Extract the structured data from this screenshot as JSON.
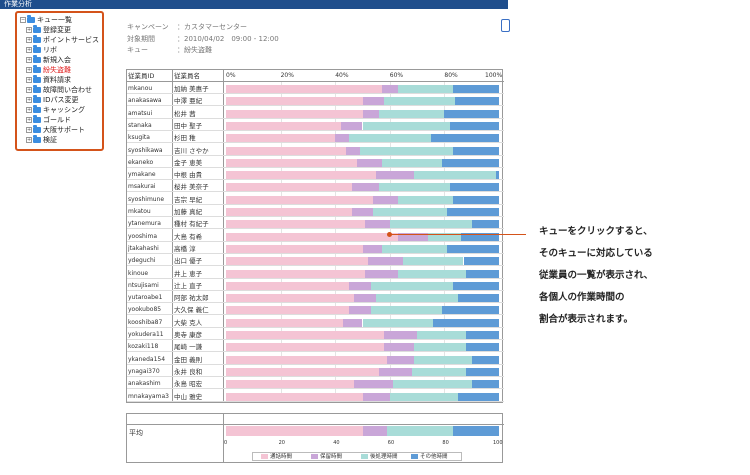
{
  "window": {
    "title": "作業分析"
  },
  "tree": {
    "root": "キュー一覧",
    "items": [
      {
        "label": "登録変更",
        "active": false
      },
      {
        "label": "ポイントサービス",
        "active": false
      },
      {
        "label": "リボ",
        "active": false
      },
      {
        "label": "新規入会",
        "active": false
      },
      {
        "label": "紛失盗難",
        "active": true
      },
      {
        "label": "資料請求",
        "active": false
      },
      {
        "label": "故障問い合わせ",
        "active": false
      },
      {
        "label": "IDパス変更",
        "active": false
      },
      {
        "label": "キャッシング",
        "active": false
      },
      {
        "label": "ゴールド",
        "active": false
      },
      {
        "label": "大阪サポート",
        "active": false
      },
      {
        "label": "検証",
        "active": false
      }
    ]
  },
  "info": {
    "campaign_key": "キャンペーン",
    "campaign_val": "：カスタマーセンター",
    "period_key": "対象期間",
    "period_val": "：2010/04/02　09:00 - 12:00",
    "queue_key": "キュー",
    "queue_val": "：紛失盗難"
  },
  "table": {
    "col_id": "従業員ID",
    "col_name": "従業員名",
    "ticks": [
      "0%",
      "20%",
      "40%",
      "60%",
      "80%",
      "100%"
    ]
  },
  "colors": {
    "call": "#f4c4d4",
    "hold": "#c9a6d8",
    "after": "#a8dcd8",
    "other": "#5e9bd6"
  },
  "chart_data": {
    "type": "bar",
    "stacked": true,
    "orientation": "horizontal",
    "xlim": [
      0,
      100
    ],
    "categories": [
      {
        "id": "mkanou",
        "name": "加納 美惠子"
      },
      {
        "id": "anakasawa",
        "name": "中澤 亜紀"
      },
      {
        "id": "amatsui",
        "name": "松井 茜"
      },
      {
        "id": "stanaka",
        "name": "田中 聖子"
      },
      {
        "id": "ksugita",
        "name": "杉田 稚"
      },
      {
        "id": "syoshikawa",
        "name": "吉川 さやか"
      },
      {
        "id": "ekaneko",
        "name": "金子 恵美"
      },
      {
        "id": "ymakane",
        "name": "中根 由貴"
      },
      {
        "id": "msakurai",
        "name": "桜井 美奈子"
      },
      {
        "id": "syoshimune",
        "name": "吉宗 早紀"
      },
      {
        "id": "mkatou",
        "name": "加藤 真紀"
      },
      {
        "id": "ytanemura",
        "name": "種村 有紀子"
      },
      {
        "id": "yooshima",
        "name": "大島 有希"
      },
      {
        "id": "jtakahashi",
        "name": "高橋 淳"
      },
      {
        "id": "ydeguchi",
        "name": "出口 優子"
      },
      {
        "id": "kinoue",
        "name": "井上 恵子"
      },
      {
        "id": "ntsujisami",
        "name": "辻上 直子"
      },
      {
        "id": "yutaroabe1",
        "name": "阿部 祐太郎"
      },
      {
        "id": "yookubo85",
        "name": "大久保 義仁"
      },
      {
        "id": "kooshiba87",
        "name": "大柴 克人"
      },
      {
        "id": "yokudera11",
        "name": "奥寺 康彦"
      },
      {
        "id": "kozaki118",
        "name": "尾崎 一謙"
      },
      {
        "id": "ykaneda154",
        "name": "金田 義則"
      },
      {
        "id": "ynagai370",
        "name": "永井 良和"
      },
      {
        "id": "anakashim",
        "name": "永島 昭宏"
      },
      {
        "id": "mnakayama3",
        "name": "中山 雅史"
      }
    ],
    "series": [
      {
        "name": "通話時間",
        "values": [
          57,
          50,
          50,
          42,
          40,
          44,
          48,
          55,
          46,
          54,
          46,
          51,
          63,
          50,
          52,
          51,
          45,
          47,
          45,
          43,
          58,
          58,
          59,
          56,
          47,
          50
        ]
      },
      {
        "name": "保留時間",
        "values": [
          6,
          8,
          6,
          8,
          5,
          5,
          9,
          14,
          10,
          9,
          8,
          9,
          11,
          7,
          13,
          12,
          8,
          8,
          8,
          7,
          12,
          11,
          10,
          12,
          14,
          10
        ]
      },
      {
        "name": "後処理時間",
        "values": [
          20,
          26,
          24,
          32,
          30,
          34,
          22,
          30,
          26,
          20,
          27,
          30,
          12,
          24,
          22,
          25,
          30,
          30,
          26,
          26,
          18,
          19,
          21,
          20,
          29,
          25
        ]
      },
      {
        "name": "その他時間",
        "values": [
          17,
          16,
          20,
          18,
          25,
          17,
          21,
          1,
          18,
          17,
          19,
          10,
          14,
          19,
          13,
          12,
          17,
          15,
          21,
          24,
          12,
          12,
          10,
          12,
          10,
          15
        ]
      }
    ],
    "average": {
      "label": "平均",
      "values": [
        50,
        9,
        24,
        17
      ]
    },
    "avg_ticks": [
      "0",
      "20",
      "40",
      "60",
      "80",
      "100"
    ]
  },
  "annotation": {
    "lines": [
      "キューをクリックすると、",
      "そのキューに対応している",
      "従業員の一覧が表示され、",
      "各個人の作業時間の",
      "割合が表示されます。"
    ]
  }
}
